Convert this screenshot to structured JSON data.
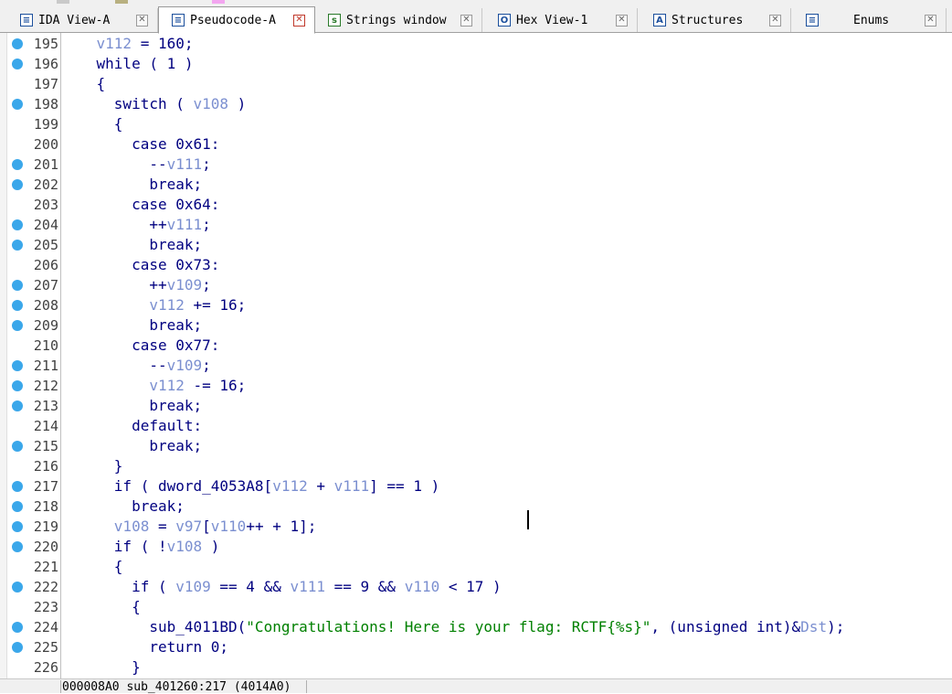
{
  "tabs": [
    {
      "label": "IDA View-A",
      "icon": "ida-view-icon",
      "active": false
    },
    {
      "label": "Pseudocode-A",
      "icon": "pseudocode-icon",
      "active": true
    },
    {
      "label": "Strings window",
      "icon": "strings-icon",
      "active": false
    },
    {
      "label": "Hex View-1",
      "icon": "hex-view-icon",
      "active": false
    },
    {
      "label": "Structures",
      "icon": "structures-icon",
      "active": false
    },
    {
      "label": "Enums",
      "icon": "enums-icon",
      "active": false
    }
  ],
  "close_glyph": "✕",
  "colors": {
    "keyword": "#000080",
    "variable": "#7b8fd0",
    "string": "#008000",
    "breakpoint_dot": "#3aa7ea",
    "active_tab_close": "#c0392b"
  },
  "code_lines": [
    {
      "n": "195",
      "dot": true,
      "tokens": [
        [
          "    ",
          "k"
        ],
        [
          "v112",
          "v"
        ],
        [
          " = 160;",
          "k"
        ]
      ]
    },
    {
      "n": "196",
      "dot": true,
      "tokens": [
        [
          "    while ( 1 )",
          "k"
        ]
      ]
    },
    {
      "n": "197",
      "dot": false,
      "tokens": [
        [
          "    {",
          "k"
        ]
      ]
    },
    {
      "n": "198",
      "dot": true,
      "tokens": [
        [
          "      switch ( ",
          "k"
        ],
        [
          "v108",
          "v"
        ],
        [
          " )",
          "k"
        ]
      ]
    },
    {
      "n": "199",
      "dot": false,
      "tokens": [
        [
          "      {",
          "k"
        ]
      ]
    },
    {
      "n": "200",
      "dot": false,
      "tokens": [
        [
          "        case 0x61:",
          "k"
        ]
      ]
    },
    {
      "n": "201",
      "dot": true,
      "tokens": [
        [
          "          --",
          "k"
        ],
        [
          "v111",
          "v"
        ],
        [
          ";",
          "k"
        ]
      ]
    },
    {
      "n": "202",
      "dot": true,
      "tokens": [
        [
          "          break;",
          "k"
        ]
      ]
    },
    {
      "n": "203",
      "dot": false,
      "tokens": [
        [
          "        case 0x64:",
          "k"
        ]
      ]
    },
    {
      "n": "204",
      "dot": true,
      "tokens": [
        [
          "          ++",
          "k"
        ],
        [
          "v111",
          "v"
        ],
        [
          ";",
          "k"
        ]
      ]
    },
    {
      "n": "205",
      "dot": true,
      "tokens": [
        [
          "          break;",
          "k"
        ]
      ]
    },
    {
      "n": "206",
      "dot": false,
      "tokens": [
        [
          "        case 0x73:",
          "k"
        ]
      ]
    },
    {
      "n": "207",
      "dot": true,
      "tokens": [
        [
          "          ++",
          "k"
        ],
        [
          "v109",
          "v"
        ],
        [
          ";",
          "k"
        ]
      ]
    },
    {
      "n": "208",
      "dot": true,
      "tokens": [
        [
          "          ",
          "k"
        ],
        [
          "v112",
          "v"
        ],
        [
          " += 16;",
          "k"
        ]
      ]
    },
    {
      "n": "209",
      "dot": true,
      "tokens": [
        [
          "          break;",
          "k"
        ]
      ]
    },
    {
      "n": "210",
      "dot": false,
      "tokens": [
        [
          "        case 0x77:",
          "k"
        ]
      ]
    },
    {
      "n": "211",
      "dot": true,
      "tokens": [
        [
          "          --",
          "k"
        ],
        [
          "v109",
          "v"
        ],
        [
          ";",
          "k"
        ]
      ]
    },
    {
      "n": "212",
      "dot": true,
      "tokens": [
        [
          "          ",
          "k"
        ],
        [
          "v112",
          "v"
        ],
        [
          " -= 16;",
          "k"
        ]
      ]
    },
    {
      "n": "213",
      "dot": true,
      "tokens": [
        [
          "          break;",
          "k"
        ]
      ]
    },
    {
      "n": "214",
      "dot": false,
      "tokens": [
        [
          "        default:",
          "k"
        ]
      ]
    },
    {
      "n": "215",
      "dot": true,
      "tokens": [
        [
          "          break;",
          "k"
        ]
      ]
    },
    {
      "n": "216",
      "dot": false,
      "tokens": [
        [
          "      }",
          "k"
        ]
      ]
    },
    {
      "n": "217",
      "dot": true,
      "tokens": [
        [
          "      if ( dword_4053A8[",
          "k"
        ],
        [
          "v112",
          "v"
        ],
        [
          " + ",
          "k"
        ],
        [
          "v111",
          "v"
        ],
        [
          "] == 1 )",
          "k"
        ]
      ]
    },
    {
      "n": "218",
      "dot": true,
      "tokens": [
        [
          "        break;",
          "k"
        ]
      ]
    },
    {
      "n": "219",
      "dot": true,
      "tokens": [
        [
          "      ",
          "k"
        ],
        [
          "v108",
          "v"
        ],
        [
          " = ",
          "k"
        ],
        [
          "v97",
          "v"
        ],
        [
          "[",
          "k"
        ],
        [
          "v110",
          "v"
        ],
        [
          "++ + 1];",
          "k"
        ]
      ]
    },
    {
      "n": "220",
      "dot": true,
      "tokens": [
        [
          "      if ( !",
          "k"
        ],
        [
          "v108",
          "v"
        ],
        [
          " )",
          "k"
        ]
      ]
    },
    {
      "n": "221",
      "dot": false,
      "tokens": [
        [
          "      {",
          "k"
        ]
      ]
    },
    {
      "n": "222",
      "dot": true,
      "tokens": [
        [
          "        if ( ",
          "k"
        ],
        [
          "v109",
          "v"
        ],
        [
          " == 4 && ",
          "k"
        ],
        [
          "v111",
          "v"
        ],
        [
          " == 9 && ",
          "k"
        ],
        [
          "v110",
          "v"
        ],
        [
          " < 17 )",
          "k"
        ]
      ]
    },
    {
      "n": "223",
      "dot": false,
      "tokens": [
        [
          "        {",
          "k"
        ]
      ]
    },
    {
      "n": "224",
      "dot": true,
      "tokens": [
        [
          "          sub_4011BD(",
          "k"
        ],
        [
          "\"Congratulations! Here is your flag: RCTF{%s}\"",
          "s"
        ],
        [
          ", (unsigned int)&",
          "k"
        ],
        [
          "Dst",
          "v"
        ],
        [
          ");",
          "k"
        ]
      ]
    },
    {
      "n": "225",
      "dot": true,
      "tokens": [
        [
          "          return 0;",
          "k"
        ]
      ]
    },
    {
      "n": "226",
      "dot": false,
      "tokens": [
        [
          "        }",
          "k"
        ]
      ]
    }
  ],
  "status": {
    "text": "000008A0 sub_401260:217 (4014A0)"
  }
}
